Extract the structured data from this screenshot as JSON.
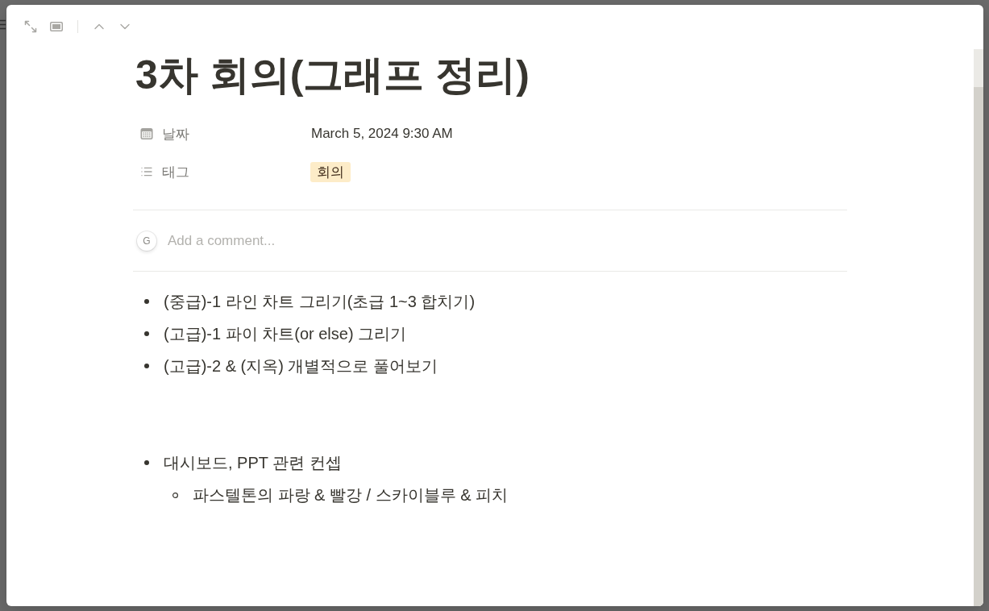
{
  "page": {
    "title": "3차 회의(그래프 정리)"
  },
  "properties": [
    {
      "kind": "date",
      "label": "날짜",
      "value": "March 5, 2024 9:30 AM"
    },
    {
      "kind": "multi_select",
      "label": "태그",
      "tags": [
        {
          "text": "회의",
          "color": "#fdecc8"
        }
      ]
    }
  ],
  "comment": {
    "avatar_initial": "G",
    "placeholder": "Add a comment..."
  },
  "blocks": [
    {
      "kind": "bulleted_list",
      "items": [
        {
          "text": "(중급)-1 라인 차트 그리기(초급 1~3 합치기)"
        },
        {
          "text": "(고급)-1 파이 차트(or else) 그리기"
        },
        {
          "text": "(고급)-2 & (지옥) 개별적으로 풀어보기"
        }
      ]
    },
    {
      "kind": "bulleted_list",
      "items": [
        {
          "text": "대시보드, PPT 관련 컨셉",
          "children": [
            {
              "text": "파스텔톤의 파랑 & 빨강 / 스카이블루 & 피치"
            }
          ]
        }
      ]
    }
  ]
}
